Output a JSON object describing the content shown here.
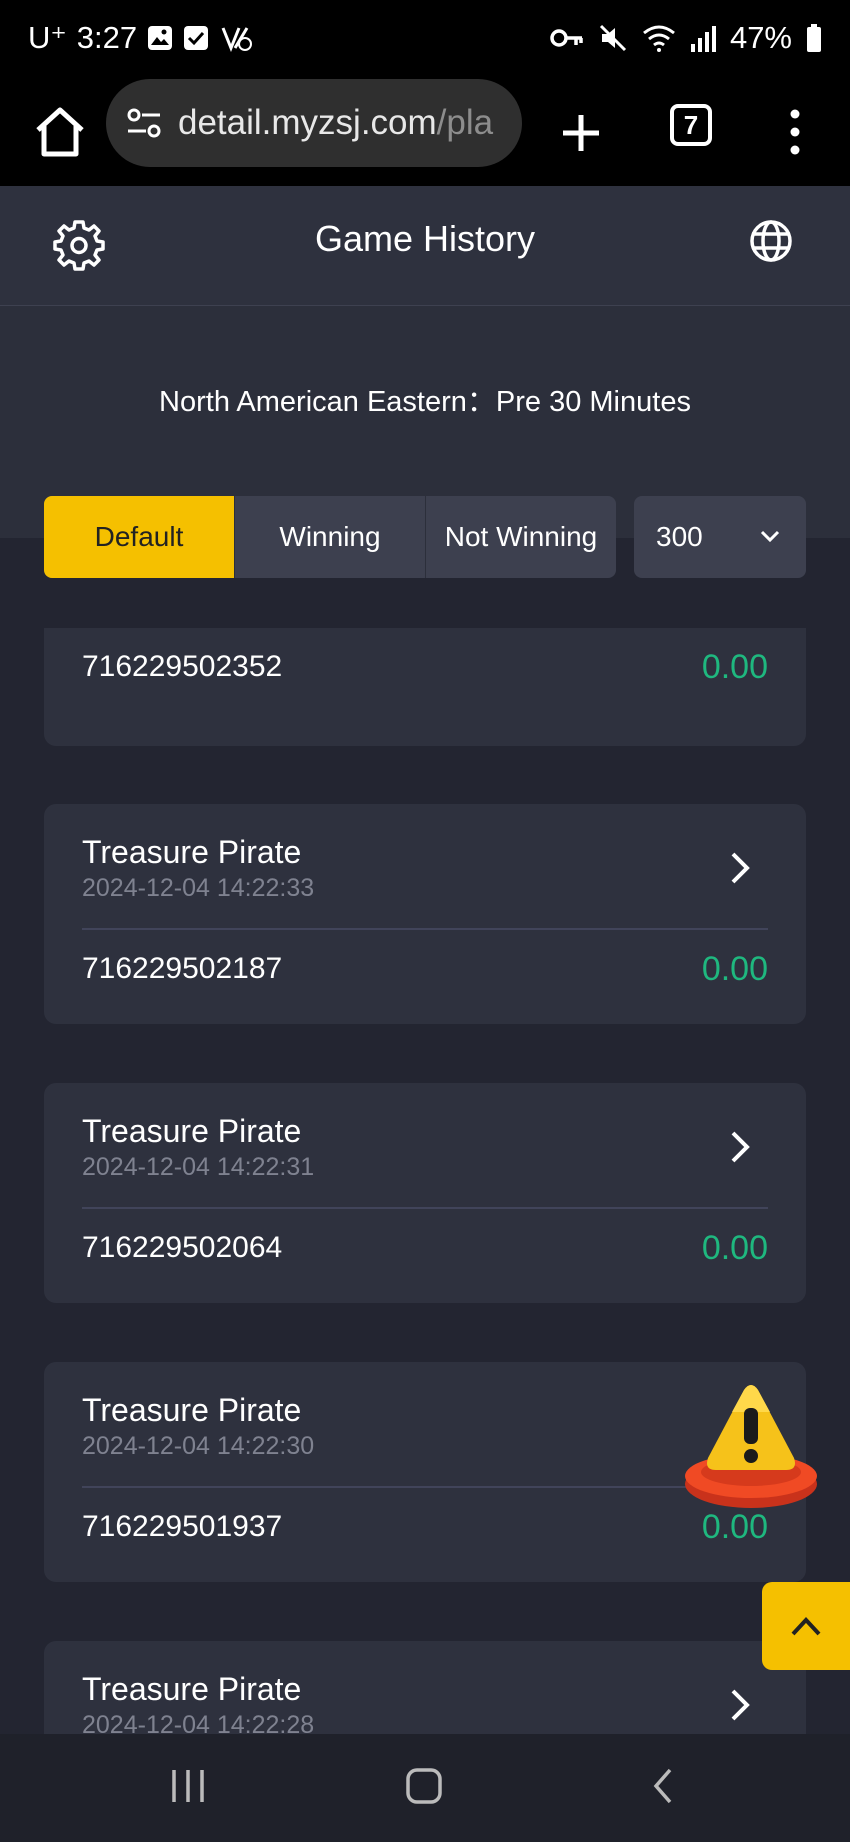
{
  "status_bar": {
    "carrier": "U⁺",
    "time": "3:27",
    "battery": "47%"
  },
  "browser": {
    "url_main": "detail.myzsj.com",
    "url_faded": "/pla",
    "tab_count": "7"
  },
  "header": {
    "title": "Game History"
  },
  "filter": {
    "timezone": "North American Eastern：Pre 30 Minutes",
    "tabs": [
      "Default",
      "Winning",
      "Not Winning"
    ],
    "count_selected": "300"
  },
  "records": [
    {
      "game": "",
      "time": "",
      "round_id": "716229502352",
      "amount": "0.00"
    },
    {
      "game": "Treasure Pirate",
      "time": "2024-12-04 14:22:33",
      "round_id": "716229502187",
      "amount": "0.00"
    },
    {
      "game": "Treasure Pirate",
      "time": "2024-12-04 14:22:31",
      "round_id": "716229502064",
      "amount": "0.00"
    },
    {
      "game": "Treasure Pirate",
      "time": "2024-12-04 14:22:30",
      "round_id": "716229501937",
      "amount": "0.00"
    },
    {
      "game": "Treasure Pirate",
      "time": "2024-12-04 14:22:28",
      "round_id": "",
      "amount": ""
    }
  ],
  "colors": {
    "accent": "#f5c000",
    "win_amount": "#1fb87f",
    "card_bg": "#2e313e"
  }
}
